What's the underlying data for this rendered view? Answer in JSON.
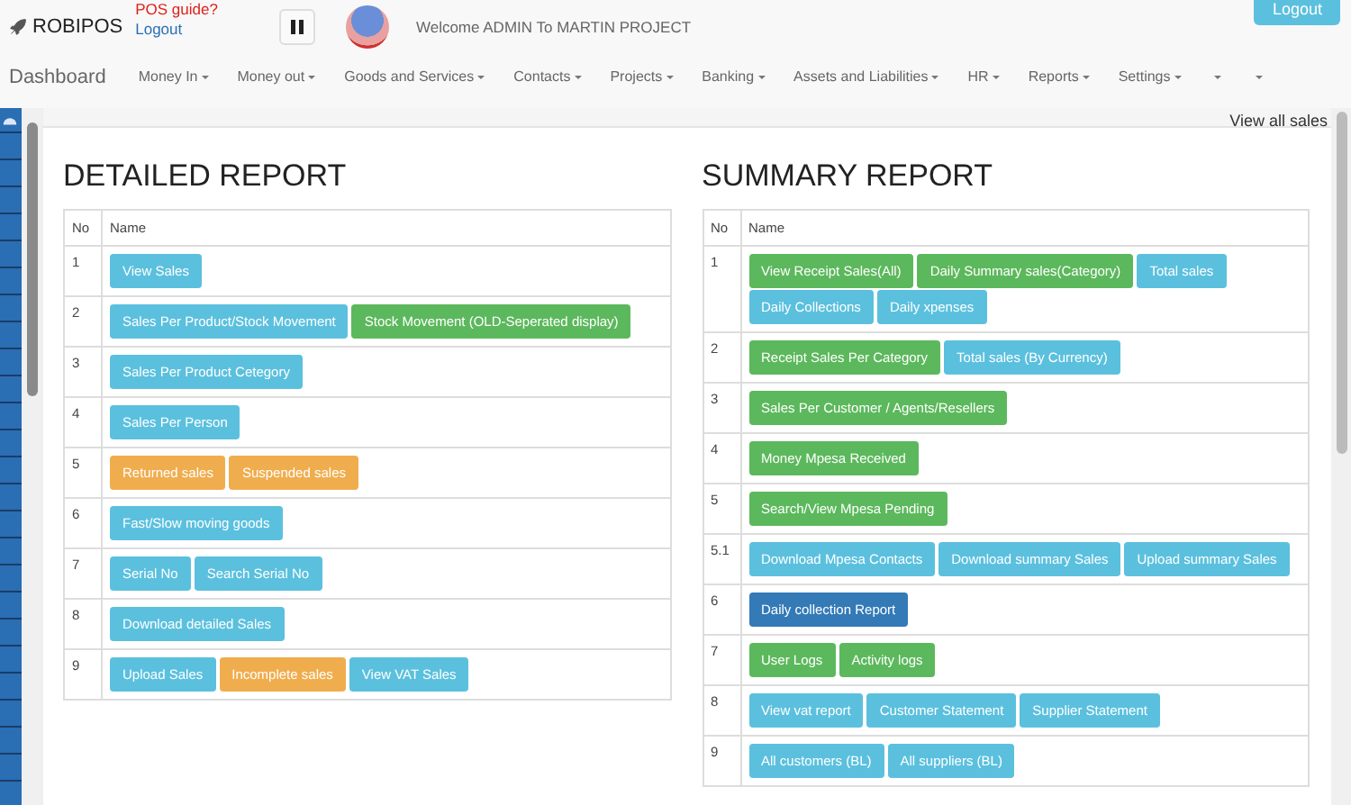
{
  "header": {
    "brand": "ROBIPOS",
    "guide_link": "POS guide?",
    "logout_link": "Logout",
    "welcome": "Welcome ADMIN To MARTIN PROJECT",
    "logout_button": "Logout"
  },
  "nav": {
    "home": "Dashboard",
    "items": [
      {
        "kind": "menu",
        "label": "Money In"
      },
      {
        "kind": "menu",
        "label": "Money out"
      },
      {
        "kind": "menu",
        "label": "Goods and Services"
      },
      {
        "kind": "menu",
        "label": "Contacts"
      },
      {
        "kind": "menu",
        "label": "Projects"
      },
      {
        "kind": "menu",
        "label": "Banking"
      },
      {
        "kind": "menu",
        "label": "Assets and Liabilities"
      },
      {
        "kind": "menu",
        "label": "HR"
      },
      {
        "kind": "menu",
        "label": "Reports"
      },
      {
        "kind": "menu",
        "label": "Settings"
      },
      {
        "kind": "caret"
      },
      {
        "kind": "caret"
      }
    ]
  },
  "view_all_link": "View all sales",
  "panels": [
    {
      "title": "DETAILED REPORT",
      "columns": [
        "No",
        "Name"
      ],
      "rows": [
        {
          "no": "1",
          "buttons": [
            {
              "kind": "info",
              "label": "View Sales"
            }
          ]
        },
        {
          "no": "2",
          "buttons": [
            {
              "kind": "info",
              "label": "Sales Per Product/Stock Movement"
            },
            {
              "kind": "success",
              "label": "Stock Movement (OLD-Seperated display)"
            }
          ]
        },
        {
          "no": "3",
          "buttons": [
            {
              "kind": "info",
              "label": "Sales Per Product Cetegory"
            }
          ]
        },
        {
          "no": "4",
          "buttons": [
            {
              "kind": "info",
              "label": "Sales Per Person"
            }
          ]
        },
        {
          "no": "5",
          "buttons": [
            {
              "kind": "warning",
              "label": "Returned sales"
            },
            {
              "kind": "warning",
              "label": "Suspended sales"
            }
          ]
        },
        {
          "no": "6",
          "buttons": [
            {
              "kind": "info",
              "label": "Fast/Slow moving goods"
            }
          ]
        },
        {
          "no": "7",
          "buttons": [
            {
              "kind": "info",
              "label": "Serial No"
            },
            {
              "kind": "info",
              "label": "Search Serial No"
            }
          ]
        },
        {
          "no": "8",
          "buttons": [
            {
              "kind": "info",
              "label": "Download detailed Sales"
            }
          ]
        },
        {
          "no": "9",
          "buttons": [
            {
              "kind": "info",
              "label": "Upload Sales"
            },
            {
              "kind": "warning",
              "label": "Incomplete sales"
            },
            {
              "kind": "info",
              "label": "View VAT Sales"
            }
          ]
        }
      ]
    },
    {
      "title": "SUMMARY REPORT",
      "columns": [
        "No",
        "Name"
      ],
      "rows": [
        {
          "no": "1",
          "buttons": [
            {
              "kind": "success",
              "label": "View Receipt Sales(All)"
            },
            {
              "kind": "success",
              "label": "Daily Summary sales(Category)"
            },
            {
              "kind": "info",
              "label": "Total sales"
            },
            {
              "kind": "info",
              "label": "Daily Collections"
            },
            {
              "kind": "info",
              "label": "Daily xpenses"
            }
          ]
        },
        {
          "no": "2",
          "buttons": [
            {
              "kind": "success",
              "label": "Receipt Sales Per Category"
            },
            {
              "kind": "info",
              "label": "Total sales (By Currency)"
            }
          ]
        },
        {
          "no": "3",
          "buttons": [
            {
              "kind": "success",
              "label": "Sales Per Customer / Agents/Resellers"
            }
          ]
        },
        {
          "no": "4",
          "buttons": [
            {
              "kind": "success",
              "label": "Money Mpesa Received"
            }
          ]
        },
        {
          "no": "5",
          "buttons": [
            {
              "kind": "success",
              "label": "Search/View Mpesa Pending"
            }
          ]
        },
        {
          "no": "5.1",
          "buttons": [
            {
              "kind": "info",
              "label": "Download Mpesa Contacts"
            },
            {
              "kind": "info",
              "label": "Download summary Sales"
            },
            {
              "kind": "info",
              "label": "Upload summary Sales"
            }
          ]
        },
        {
          "no": "6",
          "buttons": [
            {
              "kind": "primary",
              "label": "Daily collection Report"
            }
          ]
        },
        {
          "no": "7",
          "buttons": [
            {
              "kind": "success",
              "label": "User Logs"
            },
            {
              "kind": "success",
              "label": "Activity logs"
            }
          ]
        },
        {
          "no": "8",
          "buttons": [
            {
              "kind": "info",
              "label": "View vat report"
            },
            {
              "kind": "info",
              "label": "Customer Statement"
            },
            {
              "kind": "info",
              "label": "Supplier Statement"
            }
          ]
        },
        {
          "no": "9",
          "buttons": [
            {
              "kind": "info",
              "label": "All customers (BL)"
            },
            {
              "kind": "info",
              "label": "All suppliers (BL)"
            }
          ]
        }
      ]
    }
  ]
}
